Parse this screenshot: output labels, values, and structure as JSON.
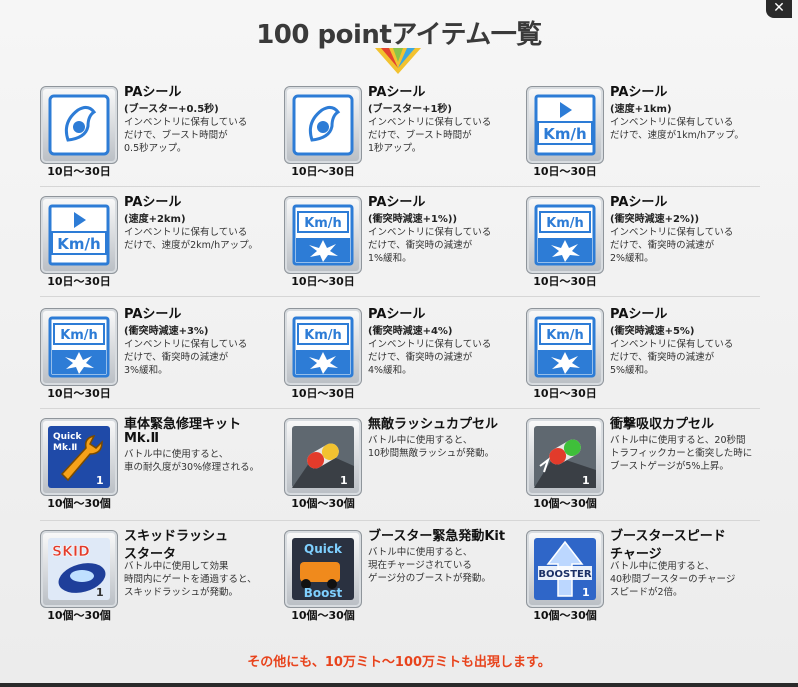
{
  "window": {
    "title": "100 pointアイテム一覧",
    "close_label": "✕"
  },
  "footer": "その他にも、10万ミト～100万ミトも出現します。",
  "colors": {
    "accent": "#e8431c",
    "icon_blue": "#2d7cd6"
  },
  "items": [
    {
      "icon": "pa-seal-boost-icon",
      "name": "PAシール",
      "sub": "(ブースター+0.5秒)",
      "desc": [
        "インベントリに保有している",
        "だけで、ブースト時間が",
        "0.5秒アップ。"
      ],
      "period": "10日～30日"
    },
    {
      "icon": "pa-seal-boost-icon",
      "name": "PAシール",
      "sub": "(ブースター+1秒)",
      "desc": [
        "インベントリに保有している",
        "だけで、ブースト時間が",
        "1秒アップ。"
      ],
      "period": "10日～30日"
    },
    {
      "icon": "pa-seal-speed-icon",
      "name": "PAシール",
      "sub": "(速度+1km)",
      "desc": [
        "インベントリに保有している",
        "だけで、速度が1km/hアップ。"
      ],
      "period": "10日～30日"
    },
    {
      "icon": "pa-seal-speed-icon",
      "name": "PAシール",
      "sub": "(速度+2km)",
      "desc": [
        "インベントリに保有している",
        "だけで、速度が2km/hアップ。"
      ],
      "period": "10日～30日"
    },
    {
      "icon": "pa-seal-impact-icon",
      "name": "PAシール",
      "sub": "(衝突時減速+1%))",
      "desc": [
        "インベントリに保有している",
        "だけで、衝突時の減速が",
        "1%緩和。"
      ],
      "period": "10日～30日"
    },
    {
      "icon": "pa-seal-impact-icon",
      "name": "PAシール",
      "sub": "(衝突時減速+2%))",
      "desc": [
        "インベントリに保有している",
        "だけで、衝突時の減速が",
        "2%緩和。"
      ],
      "period": "10日～30日"
    },
    {
      "icon": "pa-seal-impact-icon",
      "name": "PAシール",
      "sub": "(衝突時減速+3%)",
      "desc": [
        "インベントリに保有している",
        "だけで、衝突時の減速が",
        "3%緩和。"
      ],
      "period": "10日～30日"
    },
    {
      "icon": "pa-seal-impact-icon",
      "name": "PAシール",
      "sub": "(衝突時減速+4%)",
      "desc": [
        "インベントリに保有している",
        "だけで、衝突時の減速が",
        "4%緩和。"
      ],
      "period": "10日～30日"
    },
    {
      "icon": "pa-seal-impact-icon",
      "name": "PAシール",
      "sub": "(衝突時減速+5%)",
      "desc": [
        "インベントリに保有している",
        "だけで、衝突時の減速が",
        "5%緩和。"
      ],
      "period": "10日～30日"
    },
    {
      "icon": "quick-repair-icon",
      "name": "車体緊急修理キット",
      "sub": "Mk.Ⅱ",
      "desc": [
        "バトル中に使用すると、",
        "車の耐久度が30%修理される。"
      ],
      "period": "10個～30個",
      "icon_label": "Quick Mk.Ⅱ",
      "count": "1"
    },
    {
      "icon": "invincible-capsule-icon",
      "name": "無敵ラッシュカプセル",
      "sub": "",
      "desc": [
        "バトル中に使用すると、",
        "10秒間無敵ラッシュが発動。"
      ],
      "period": "10個～30個",
      "count": "1"
    },
    {
      "icon": "shock-capsule-icon",
      "name": "衝撃吸収カプセル",
      "sub": "",
      "desc": [
        "バトル中に使用すると、20秒間",
        "トラフィックカーと衝突した時に",
        "ブーストゲージが5%上昇。"
      ],
      "period": "10個～30個",
      "count": "1"
    },
    {
      "icon": "skid-rush-icon",
      "name": "スキッドラッシュ",
      "sub": "スタータ",
      "desc": [
        "バトル中に使用して効果",
        "時間内にゲートを通過すると、",
        "スキッドラッシュが発動。"
      ],
      "period": "10個～30個",
      "icon_label": "SKID",
      "count": "1"
    },
    {
      "icon": "quick-boost-icon",
      "name": "ブースター緊急発動Kit",
      "sub": "",
      "desc": [
        "バトル中に使用すると、",
        "現在チャージされている",
        "ゲージ分のブーストが発動。"
      ],
      "period": "10個～30個",
      "icon_label": "Quick Boost",
      "count": "1"
    },
    {
      "icon": "booster-speed-icon",
      "name": "ブースタースピード",
      "sub": "チャージ",
      "desc": [
        "バトル中に使用すると、",
        "40秒間ブースターのチャージ",
        "スピードが2倍。"
      ],
      "period": "10個～30個",
      "icon_label": "BOOSTER",
      "count": "1"
    }
  ]
}
